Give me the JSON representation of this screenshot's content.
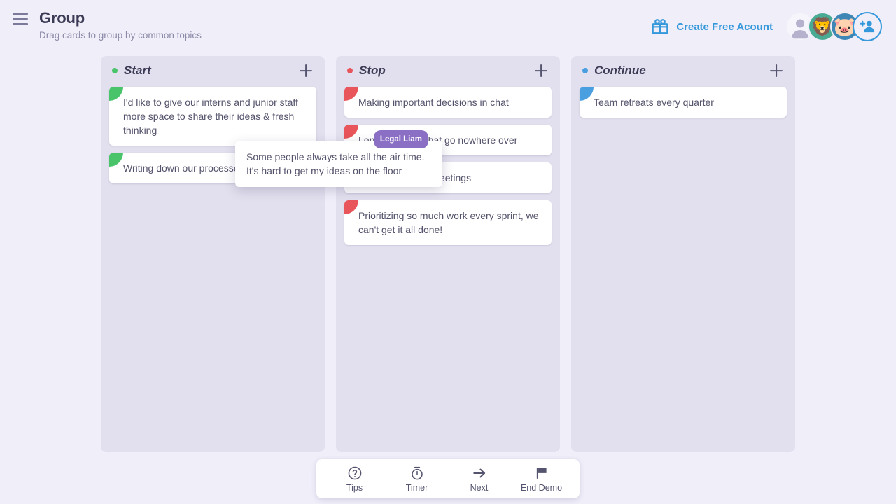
{
  "header": {
    "menu_icon": "hamburger-icon",
    "title": "Group",
    "subtitle": "Drag cards to group by common topics",
    "cta": {
      "icon": "gift-icon",
      "label": "Create Free Acount",
      "color": "#3498db"
    },
    "avatars": [
      {
        "name": "anonymous-user",
        "glyph": "",
        "bg": "#f6f5fb"
      },
      {
        "name": "lion-user",
        "glyph": "🦁",
        "bg": "#4aab94"
      },
      {
        "name": "pig-user",
        "glyph": "🐷",
        "bg": "#3d86b5"
      },
      {
        "name": "add-participant",
        "glyph": "",
        "bg": "#f0eef9"
      }
    ]
  },
  "board": {
    "columns": [
      {
        "title": "Start",
        "dot_color": "#4ac46a",
        "marker_color": "#4ac46a",
        "add_label": "+",
        "cards": [
          {
            "text": "I'd like to give our interns and junior staff more space to share their ideas & fresh thinking"
          },
          {
            "text": "Writing down our processes"
          }
        ]
      },
      {
        "title": "Stop",
        "dot_color": "#e8555a",
        "marker_color": "#e8555a",
        "add_label": "+",
        "cards": [
          {
            "text": "Making important decisions in chat"
          },
          {
            "text": "Long meetings that go nowhere over"
          },
          {
            "text": "Having so many meetings"
          },
          {
            "text": " Prioritizing so much work every sprint, we can't get it all done!"
          }
        ]
      },
      {
        "title": "Continue",
        "dot_color": "#4a9fe0",
        "marker_color": "#4a9fe0",
        "add_label": "+",
        "cards": [
          {
            "text": "Team retreats every quarter"
          }
        ]
      }
    ]
  },
  "drag_card": {
    "badge": "Legal Liam",
    "badge_color": "#8b6fc4",
    "text": "Some people always take all the air time. It's hard to get my ideas on the floor"
  },
  "toolbar": {
    "items": [
      {
        "icon": "help-circle-icon",
        "label": "Tips"
      },
      {
        "icon": "stopwatch-icon",
        "label": "Timer"
      },
      {
        "icon": "arrow-right-icon",
        "label": "Next"
      },
      {
        "icon": "flag-icon",
        "label": "End Demo"
      }
    ]
  }
}
